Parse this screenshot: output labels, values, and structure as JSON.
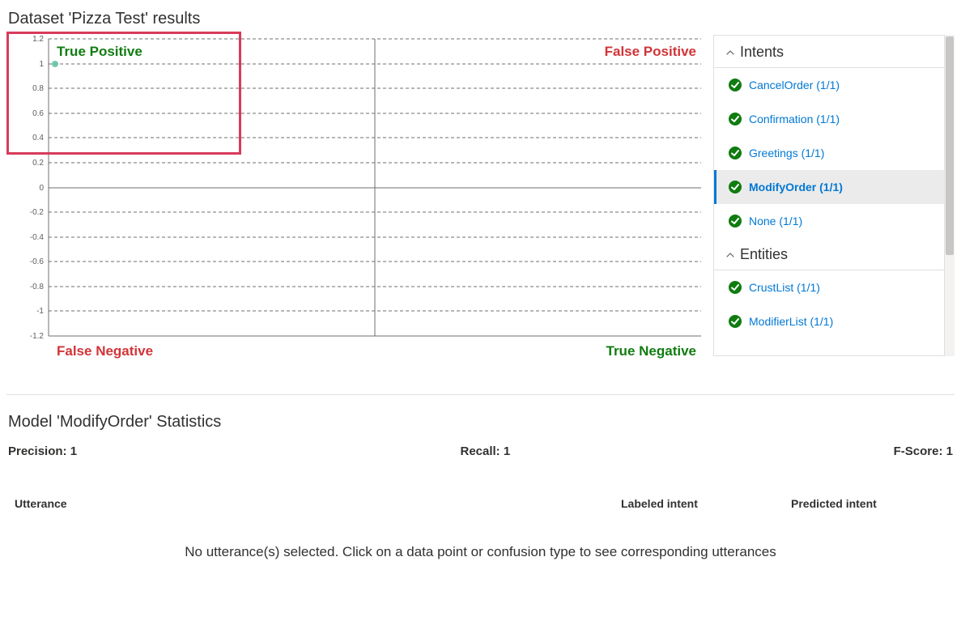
{
  "title": "Dataset 'Pizza Test' results",
  "chart_data": {
    "type": "scatter",
    "x_range": [
      0,
      1
    ],
    "y_ticks": [
      -1.2,
      -1,
      -0.8,
      -0.6,
      -0.4,
      -0.2,
      0,
      0.2,
      0.4,
      0.6,
      0.8,
      1,
      1.2
    ],
    "series": [
      {
        "name": "points",
        "points": [
          {
            "x": 0.01,
            "y": 1
          }
        ]
      }
    ],
    "quadrant_labels": {
      "top_left": "True Positive",
      "top_right": "False Positive",
      "bottom_left": "False Negative",
      "bottom_right": "True Negative"
    }
  },
  "sidebar": {
    "sections": [
      {
        "title": "Intents",
        "items": [
          {
            "label": "CancelOrder (1/1)",
            "ok": true,
            "selected": false
          },
          {
            "label": "Confirmation (1/1)",
            "ok": true,
            "selected": false
          },
          {
            "label": "Greetings (1/1)",
            "ok": true,
            "selected": false
          },
          {
            "label": "ModifyOrder (1/1)",
            "ok": true,
            "selected": true
          },
          {
            "label": "None (1/1)",
            "ok": true,
            "selected": false
          }
        ]
      },
      {
        "title": "Entities",
        "items": [
          {
            "label": "CrustList (1/1)",
            "ok": true,
            "selected": false
          },
          {
            "label": "ModifierList (1/1)",
            "ok": true,
            "selected": false
          }
        ]
      }
    ]
  },
  "stats": {
    "title": "Model 'ModifyOrder' Statistics",
    "precision_label": "Precision: 1",
    "recall_label": "Recall: 1",
    "fscore_label": "F-Score: 1"
  },
  "table": {
    "col_utterance": "Utterance",
    "col_labeled": "Labeled intent",
    "col_predicted": "Predicted intent",
    "empty_message": "No utterance(s) selected. Click on a data point or confusion type to see corresponding utterances"
  }
}
